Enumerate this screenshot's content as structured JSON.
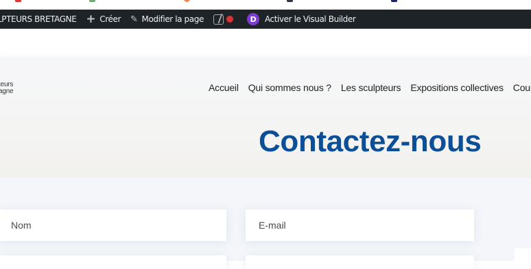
{
  "adminbar": {
    "site_name": "LPTEURS BRETAGNE",
    "create_label": "Créer",
    "edit_page_label": "Modifier la page",
    "visual_builder_label": "Activer le Visual Builder",
    "divi_letter": "D"
  },
  "header": {
    "logo_line1": "teurs",
    "logo_line2": "agne",
    "nav": [
      "Accueil",
      "Qui sommes nous ?",
      "Les sculpteurs",
      "Expositions collectives",
      "Cour"
    ]
  },
  "hero": {
    "title": "Contactez-nous"
  },
  "form": {
    "name_placeholder": "Nom",
    "email_placeholder": "E-mail"
  },
  "colors": {
    "adminbar_bg": "#1d2327",
    "title": "#0c4f97",
    "divi_purple": "#7e3bd0",
    "status_red": "#dc3232"
  }
}
